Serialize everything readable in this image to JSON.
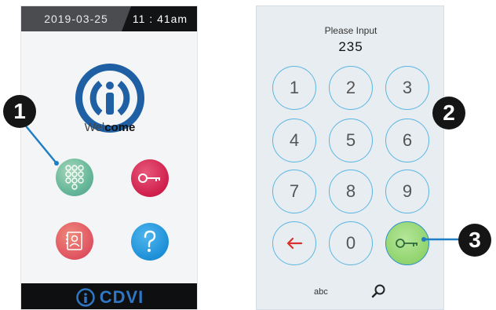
{
  "left_screen": {
    "date": "2019-03-25",
    "time": "11 : 41am",
    "welcome_part1": "Wel",
    "welcome_part2": "come",
    "buttons": [
      "keypad-icon",
      "key-icon",
      "contacts-icon",
      "help-icon"
    ],
    "brand": "CDVI"
  },
  "right_screen": {
    "prompt": "Please Input",
    "entry": "235",
    "keys": [
      "1",
      "2",
      "3",
      "4",
      "5",
      "6",
      "7",
      "8",
      "9",
      "0"
    ],
    "keyboard_label": "abc"
  },
  "callouts": [
    "1",
    "2",
    "3"
  ],
  "colors": {
    "accent_blue": "#2f77c4",
    "key_border": "#5cb6e2",
    "ok_green": "#8ed26a",
    "back_red": "#d9322f",
    "key_btn": "#cf1f4c",
    "help_btn": "#1d8fd7"
  }
}
